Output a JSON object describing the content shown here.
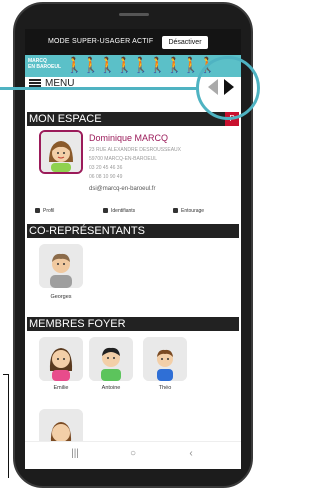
{
  "banner": {
    "mode_text": "MODE SUPER-USAGER ACTIF",
    "deactivate_label": "Désactiver"
  },
  "logo": {
    "line1": "MARCQ",
    "line2": "EN BAROEUL",
    "people": "🚶🚶🚶🚶🚶🚶🚶🚶🚶"
  },
  "menu": {
    "label": "MENU"
  },
  "mon_espace": {
    "title": "MON ESPACE",
    "badge": "P",
    "name": "Dominique MARCQ",
    "address_lines": [
      "23 RUE ALEXANDRE DESROUSSEAUX",
      "59700 MARCQ-EN-BAROEUL",
      "03 20 45 46 36",
      "06 08 10 90 49"
    ],
    "email": "dsi@marcq-en-baroeul.fr",
    "tabs": [
      "Profil",
      "Identifiants",
      "Entourage"
    ]
  },
  "co_representants": {
    "title": "CO-REPRÉSENTANTS",
    "people": [
      "Georges"
    ]
  },
  "membres_foyer": {
    "title": "MEMBRES FOYER",
    "people": [
      "Emilie",
      "Antoine",
      "Théo"
    ]
  },
  "colors": {
    "accent": "#9b1b5a",
    "header": "#222222",
    "callout": "#4fb3c2",
    "strip": "#5bc0c8"
  }
}
